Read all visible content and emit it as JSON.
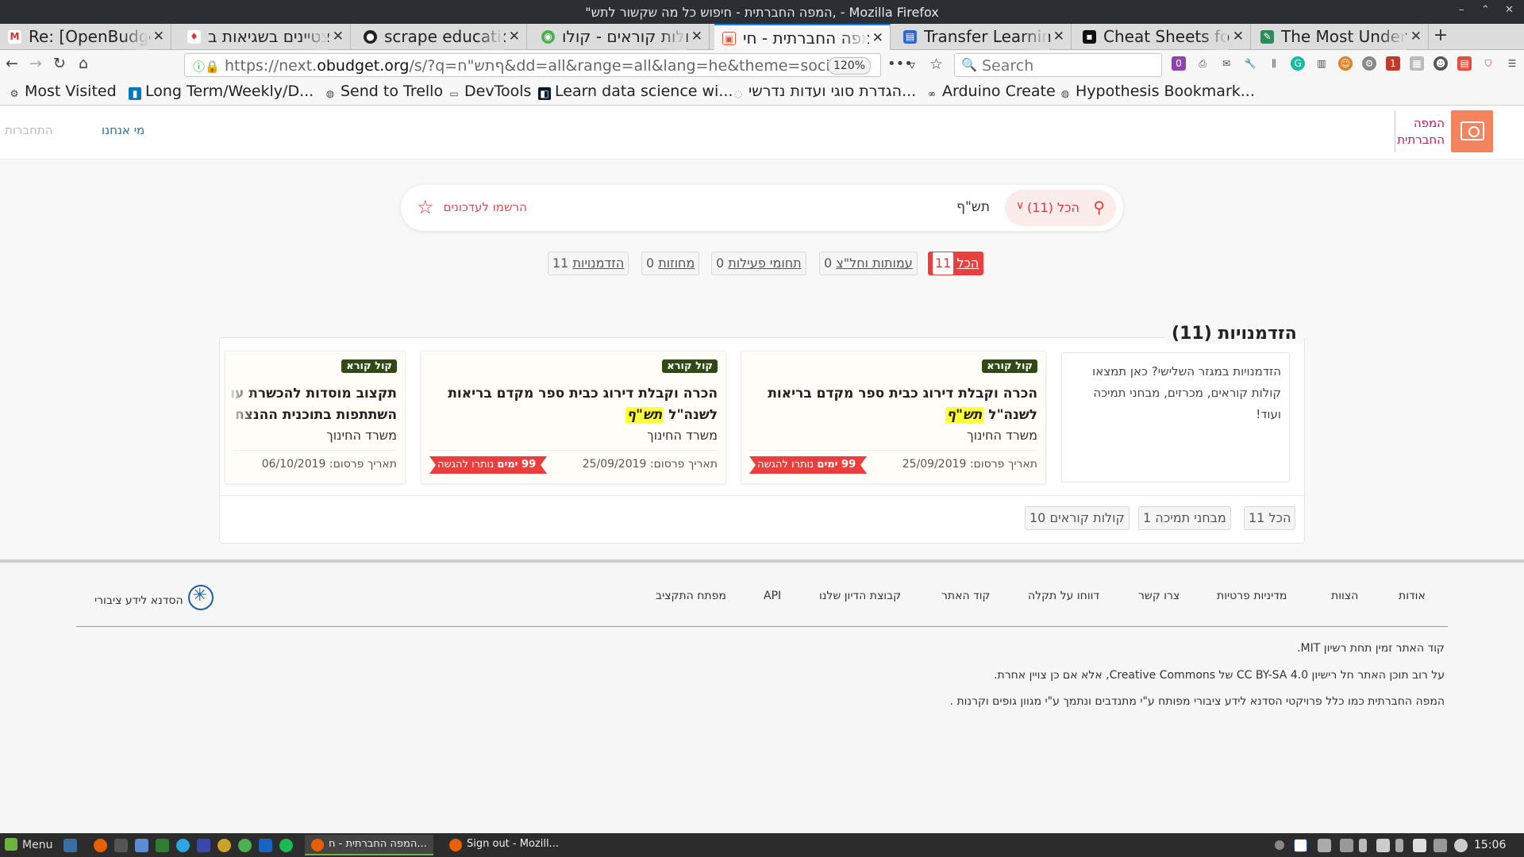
{
  "window": {
    "title": "\"המפה החברתית - חיפוש כל מה שקשור לתש, - Mozilla Firefox"
  },
  "tabs": [
    {
      "label": "Re: [OpenBudget/",
      "icon": "gmail-icon",
      "color": "#d93025"
    },
    {
      "label": "המצטיינים בשגיאות ב",
      "icon": "red-pin-icon",
      "color": "#d33"
    },
    {
      "label": "scrape education",
      "icon": "github-icon",
      "color": "#222"
    },
    {
      "label": "קולות קוראים - קולו",
      "icon": "chrome-icon",
      "color": "#4caf50"
    },
    {
      "label": "המפה החברתית - חי",
      "icon": "obudget-icon",
      "color": "#e0563a",
      "active": true
    },
    {
      "label": "Transfer Learning",
      "icon": "doc-icon",
      "color": "#3367d6"
    },
    {
      "label": "Cheat Sheets for A",
      "icon": "medium-icon",
      "color": "#111"
    },
    {
      "label": "The Most Underra",
      "icon": "pen-icon",
      "color": "#2e8b57"
    }
  ],
  "nav": {
    "url_prefix": "https://next.",
    "url_domain": "obudget.org",
    "url_rest": "/s/?q=ףתש\"ח&dd=all&range=all&lang=he&theme=social",
    "zoom": "120%",
    "search_placeholder": "Search"
  },
  "bookmarks": [
    {
      "label": "Most Visited",
      "icon": "gear-icon"
    },
    {
      "label": "Long Term/Weekly/D...",
      "icon": "trello-icon"
    },
    {
      "label": "Send to Trello",
      "icon": "globe-icon"
    },
    {
      "label": "DevTools",
      "icon": "folder-icon"
    },
    {
      "label": "Learn data science wi...",
      "icon": "datacamp-icon"
    },
    {
      "label": "הגדרת סוגי ועדות נדרשי...",
      "icon": "circle-icon"
    },
    {
      "label": "Arduino Create",
      "icon": "arduino-icon"
    },
    {
      "label": "Hypothesis Bookmark...",
      "icon": "globe-icon"
    }
  ],
  "site": {
    "logo_line1": "המפה",
    "logo_line2": "החברתית",
    "nav_about": "מי אנחנו",
    "nav_login": "התחברות"
  },
  "search": {
    "filter_label": "הכל (11)",
    "query": "תש\"ף",
    "subscribe": "הרשמו לעדכונים"
  },
  "filter_tabs": [
    {
      "label": "הכל",
      "count": "11",
      "active": true
    },
    {
      "label": "עמותות וחל\"צ",
      "count": "0"
    },
    {
      "label": "תחומי פעילות",
      "count": "0"
    },
    {
      "label": "מחוזות",
      "count": "0"
    },
    {
      "label": "הזדמנויות",
      "count": "11"
    }
  ],
  "results": {
    "title": "הזדמנויות (11)",
    "intro": "הזדמנויות במגזר השלישי? כאן תמצאו קולות קוראים, מכרזים, מבחני תמיכה ועוד!",
    "cards": [
      {
        "badge": "קול קורא",
        "title_line1": "הכרה וקבלת דירוג כבית ספר מקדם בריאות",
        "title_pre": "לשנה\"ל ",
        "title_highlight": "תש\"ף",
        "org": "משרד החינוך",
        "date": "תאריך פרסום: 25/09/2019",
        "days_num": "99 ימים",
        "days_text": "נותרו להגשה"
      },
      {
        "badge": "קול קורא",
        "title_line1": "הכרה וקבלת דירוג כבית ספר מקדם בריאות",
        "title_pre": "לשנה\"ל ",
        "title_highlight": "תש\"ף",
        "org": "משרד החינוך",
        "date": "תאריך פרסום: 25/09/2019",
        "days_num": "99 ימים",
        "days_text": "נותרו להגשה"
      },
      {
        "badge": "קול קורא",
        "title_line1": "תקצוב מוסדות להכשרת עו",
        "title_line2": "השתתפות בתוכנית ההנצח",
        "org": "משרד החינוך",
        "date": "תאריך פרסום: 06/10/2019"
      }
    ],
    "sub_tabs": [
      {
        "label": "הכל",
        "count": "11"
      },
      {
        "label": "מבחני תמיכה",
        "count": "1"
      },
      {
        "label": "קולות קוראים",
        "count": "10"
      }
    ]
  },
  "footer": {
    "links": [
      "אודות",
      "הצוות",
      "מדיניות פרטיות",
      "צרו קשר",
      "דווחו על תקלה",
      "קוד האתר",
      "קבוצת הדיון שלנו",
      "API",
      "מפתח התקציב"
    ],
    "hasadna": "הסדנא לידע ציבורי",
    "line1": "קוד האתר זמין תחת רשיון MIT.",
    "line2": "על רוב תוכן האתר חל רישיון CC BY-SA 4.0 של Creative Commons, אלא אם כן צויין אחרת.",
    "line3": "המפה החברתית כמו כלל פרויקטי הסדנא לידע ציבורי מפותח ע\"י מתנדבים ונתמך ע\"י מגוון גופים וקרנות ."
  },
  "taskbar": {
    "menu": "Menu",
    "task1": "המפה החברתית - ח...",
    "task2": "Sign out - Mozill...",
    "clock": "15:06"
  }
}
